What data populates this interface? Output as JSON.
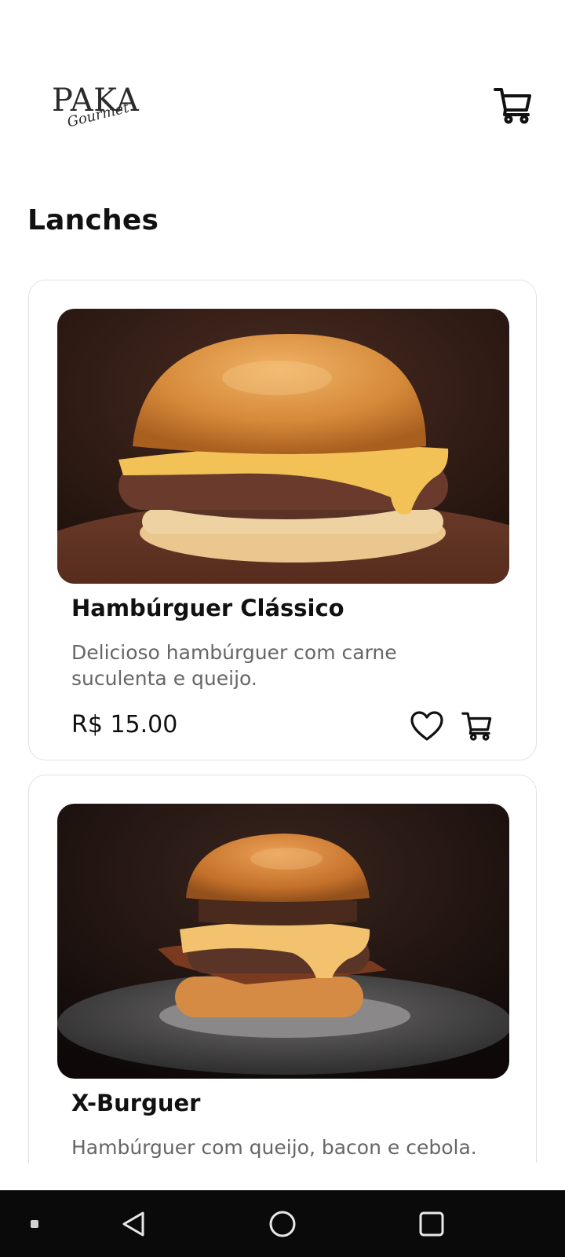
{
  "header": {
    "logo_main": "PAKA",
    "logo_script": "Gourmet",
    "cart_icon": "cart-icon"
  },
  "section": {
    "title": "Lanches"
  },
  "products": [
    {
      "name": "Hambúrguer Clássico",
      "description": "Delicioso hambúrguer com carne suculenta e queijo.",
      "price": "R$ 15.00",
      "image": "burger-classic-photo",
      "favorite_icon": "heart-icon",
      "add_icon": "cart-icon"
    },
    {
      "name": "X-Burguer",
      "description": "Hambúrguer com queijo, bacon e cebola.",
      "image": "burger-x-photo"
    }
  ],
  "nav_bar": {
    "items": [
      "dot-icon",
      "back-icon",
      "home-icon",
      "recents-icon"
    ]
  }
}
